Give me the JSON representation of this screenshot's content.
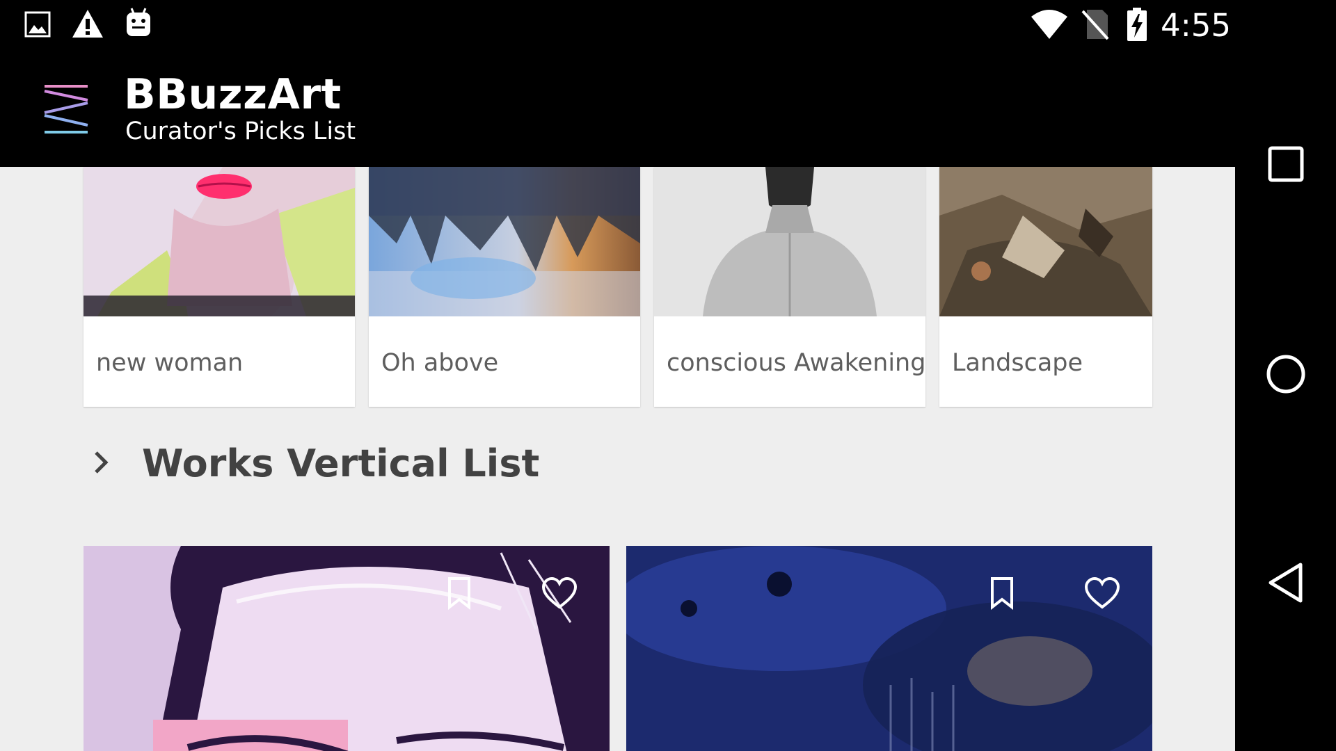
{
  "status_bar": {
    "time": "4:55",
    "left_icons": [
      "image-icon",
      "warning-icon",
      "android-icon"
    ],
    "right_icons": [
      "wifi-icon",
      "no-sim-icon",
      "battery-charging-icon"
    ]
  },
  "app_bar": {
    "title": "BBuzzArt",
    "subtitle": "Curator's Picks List",
    "menu_icon": "menu-icon"
  },
  "picks": [
    {
      "title": "new woman"
    },
    {
      "title": "Oh above"
    },
    {
      "title": "conscious Awakening"
    },
    {
      "title": "Landscape"
    }
  ],
  "section": {
    "title": "Works Vertical List",
    "icon": "chevron-right-icon"
  },
  "works": [
    {
      "actions": [
        "bookmark-icon",
        "heart-icon"
      ]
    },
    {
      "actions": [
        "bookmark-icon",
        "heart-icon"
      ]
    }
  ],
  "nav_bar": {
    "buttons": [
      "recents-icon",
      "home-icon",
      "back-icon"
    ]
  },
  "colors": {
    "background": "#eeeeee",
    "app_bar": "#000000",
    "card": "#ffffff",
    "label_text": "#5e5e5e",
    "section_title": "#424242"
  }
}
